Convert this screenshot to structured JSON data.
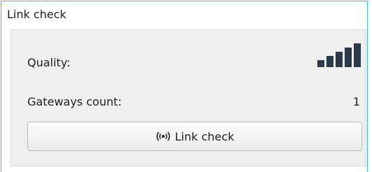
{
  "panel": {
    "title": "Link check"
  },
  "quality": {
    "label": "Quality:",
    "icon": "signal-bars-icon",
    "bars_filled": 5,
    "bars_total": 5,
    "color": "#2b3a4a"
  },
  "gateways": {
    "label": "Gateways count:",
    "value": "1"
  },
  "button": {
    "label": "Link check",
    "icon": "broadcast-icon"
  },
  "colors": {
    "panel_border": "#41b6e6",
    "inner_background": "#efefef"
  }
}
